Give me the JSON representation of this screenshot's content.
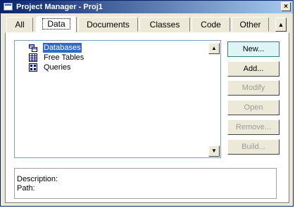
{
  "window": {
    "title": "Project Manager - Proj1",
    "close_glyph": "×"
  },
  "tabs": [
    {
      "label": "All"
    },
    {
      "label": "Data"
    },
    {
      "label": "Documents"
    },
    {
      "label": "Classes"
    },
    {
      "label": "Code"
    },
    {
      "label": "Other"
    }
  ],
  "tab_scroll_glyph": "▲",
  "tree": {
    "items": [
      {
        "label": "Databases",
        "icon": "database-icon",
        "selected": true
      },
      {
        "label": "Free Tables",
        "icon": "table-icon"
      },
      {
        "label": "Queries",
        "icon": "query-icon"
      }
    ]
  },
  "scrollbar": {
    "up_glyph": "▲",
    "down_glyph": "▼"
  },
  "buttons": {
    "new": "New...",
    "add": "Add...",
    "modify": "Modify",
    "open": "Open",
    "remove": "Remove...",
    "build": "Build..."
  },
  "info": {
    "description_label": "Description:",
    "path_label": "Path:"
  },
  "colors": {
    "title_start": "#0a246a",
    "title_end": "#a6caf0",
    "selection": "#316ac5",
    "default_button": "#dff5f5"
  }
}
